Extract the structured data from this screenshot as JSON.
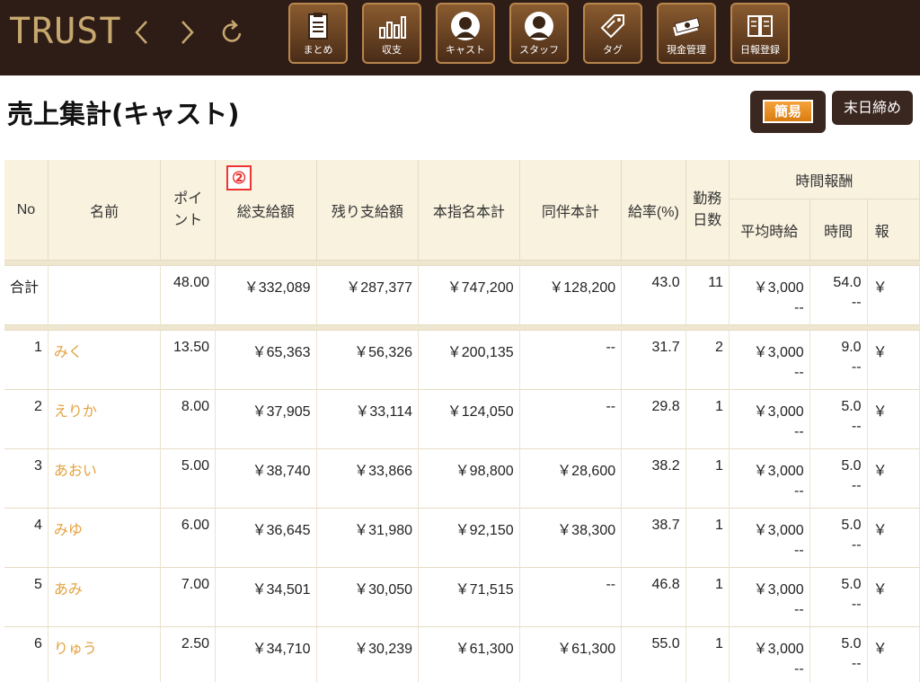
{
  "app": {
    "logo": "TRUST",
    "nav_buttons": [
      {
        "label": "まとめ",
        "icon": "clipboard-icon"
      },
      {
        "label": "収支",
        "icon": "bar-chart-icon"
      },
      {
        "label": "キャスト",
        "icon": "cast-person-icon"
      },
      {
        "label": "スタッフ",
        "icon": "staff-person-icon"
      },
      {
        "label": "タグ",
        "icon": "tag-icon"
      },
      {
        "label": "現金管理",
        "icon": "cash-icon"
      },
      {
        "label": "日報登録",
        "icon": "book-icon"
      }
    ]
  },
  "page": {
    "title": "売上集計(キャスト)",
    "simple_label": "簡易",
    "closing_label": "末日締め",
    "annotation_marker": "②"
  },
  "table": {
    "headers": {
      "no": "No",
      "name": "名前",
      "points": "ポイント",
      "total_pay": "総支給額",
      "remaining_pay": "残り支給額",
      "honshimei": "本指名本計",
      "douhan": "同伴本計",
      "rate": "給率(%)",
      "workdays": "勤務日数",
      "hourly_group": "時間報酬",
      "avg_hourly": "平均時給",
      "hours": "時間",
      "cut": "報"
    },
    "total": {
      "label": "合計",
      "points": "48.00",
      "total_pay": "￥332,089",
      "remaining_pay": "￥287,377",
      "honshimei": "￥747,200",
      "douhan": "￥128,200",
      "rate": "43.0",
      "workdays": "11",
      "avg_hourly": "￥3,000",
      "avg_hourly_sub": "--",
      "hours": "54.0",
      "hours_sub": "--",
      "cut": "￥"
    },
    "rows": [
      {
        "no": "1",
        "name": "みく",
        "points": "13.50",
        "total_pay": "￥65,363",
        "remaining_pay": "￥56,326",
        "honshimei": "￥200,135",
        "douhan": "--",
        "rate": "31.7",
        "workdays": "2",
        "avg_hourly": "￥3,000",
        "avg_hourly_sub": "--",
        "hours": "9.0",
        "hours_sub": "--",
        "cut": "￥"
      },
      {
        "no": "2",
        "name": "えりか",
        "points": "8.00",
        "total_pay": "￥37,905",
        "remaining_pay": "￥33,114",
        "honshimei": "￥124,050",
        "douhan": "--",
        "rate": "29.8",
        "workdays": "1",
        "avg_hourly": "￥3,000",
        "avg_hourly_sub": "--",
        "hours": "5.0",
        "hours_sub": "--",
        "cut": "￥"
      },
      {
        "no": "3",
        "name": "あおい",
        "points": "5.00",
        "total_pay": "￥38,740",
        "remaining_pay": "￥33,866",
        "honshimei": "￥98,800",
        "douhan": "￥28,600",
        "rate": "38.2",
        "workdays": "1",
        "avg_hourly": "￥3,000",
        "avg_hourly_sub": "--",
        "hours": "5.0",
        "hours_sub": "--",
        "cut": "￥"
      },
      {
        "no": "4",
        "name": "みゆ",
        "points": "6.00",
        "total_pay": "￥36,645",
        "remaining_pay": "￥31,980",
        "honshimei": "￥92,150",
        "douhan": "￥38,300",
        "rate": "38.7",
        "workdays": "1",
        "avg_hourly": "￥3,000",
        "avg_hourly_sub": "--",
        "hours": "5.0",
        "hours_sub": "--",
        "cut": "￥"
      },
      {
        "no": "5",
        "name": "あみ",
        "points": "7.00",
        "total_pay": "￥34,501",
        "remaining_pay": "￥30,050",
        "honshimei": "￥71,515",
        "douhan": "--",
        "rate": "46.8",
        "workdays": "1",
        "avg_hourly": "￥3,000",
        "avg_hourly_sub": "--",
        "hours": "5.0",
        "hours_sub": "--",
        "cut": "￥"
      },
      {
        "no": "6",
        "name": "りゅう",
        "points": "2.50",
        "total_pay": "￥34,710",
        "remaining_pay": "￥30,239",
        "honshimei": "￥61,300",
        "douhan": "￥61,300",
        "rate": "55.0",
        "workdays": "1",
        "avg_hourly": "￥3,000",
        "avg_hourly_sub": "--",
        "hours": "5.0",
        "hours_sub": "--",
        "cut": "￥"
      }
    ]
  }
}
